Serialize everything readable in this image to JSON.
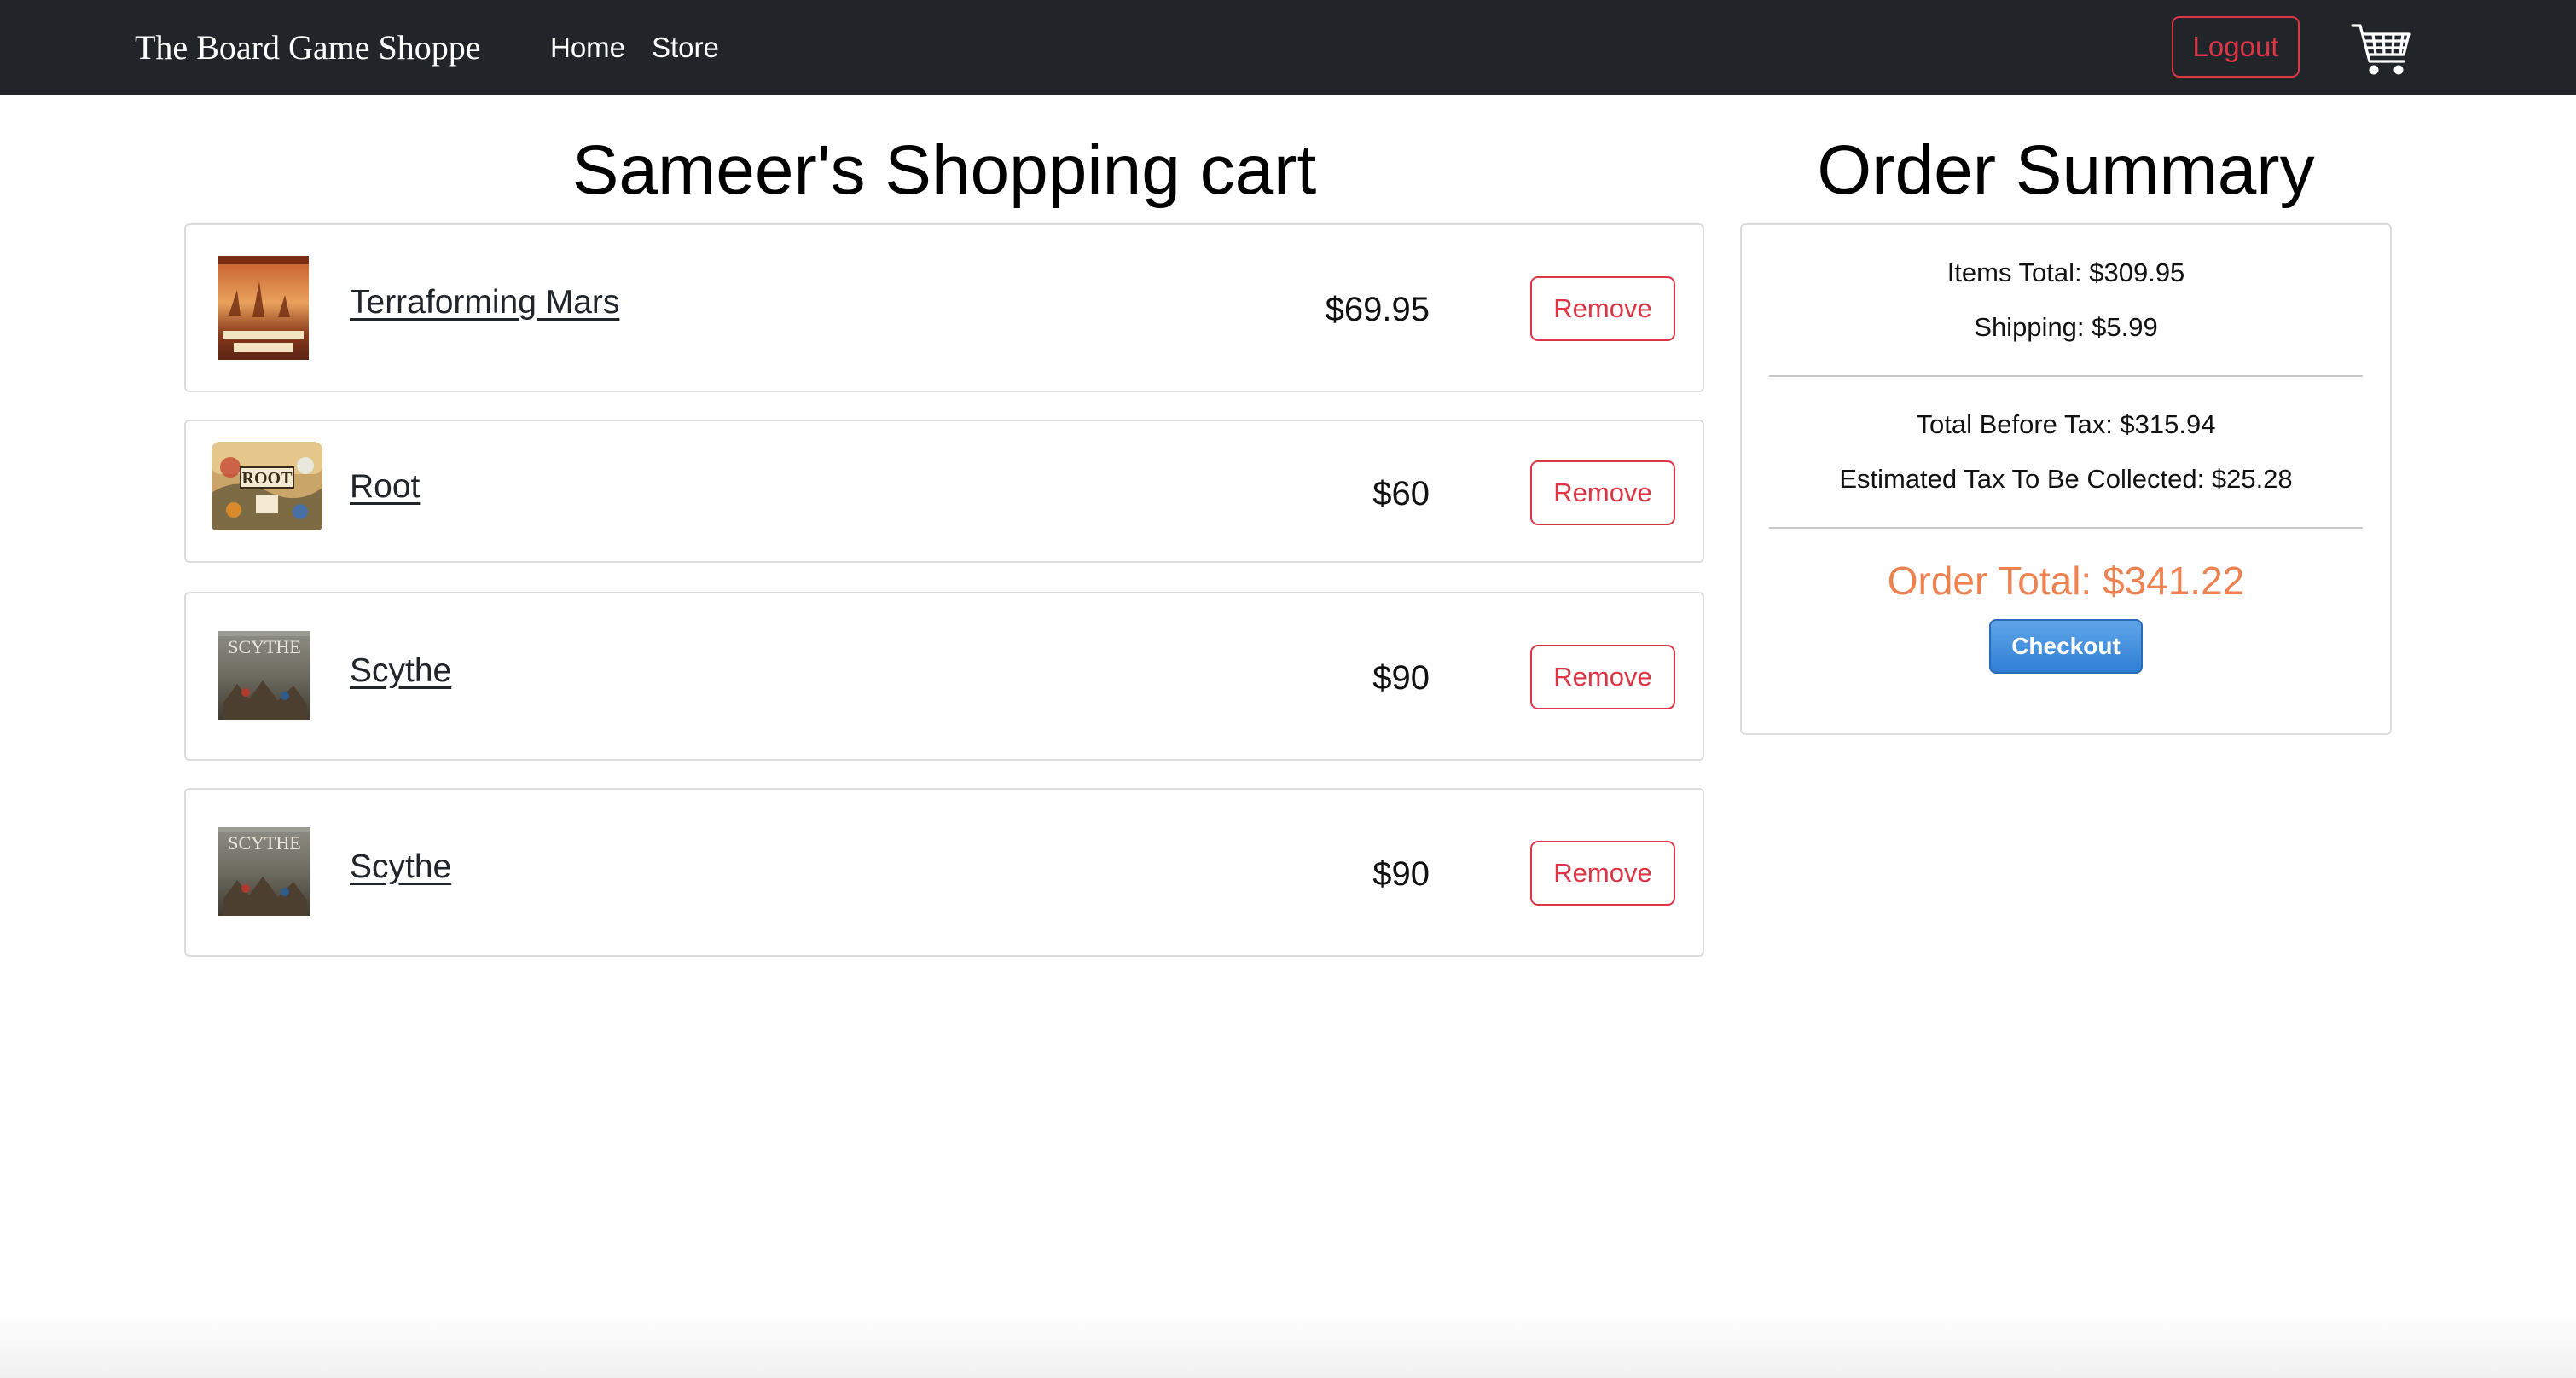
{
  "navbar": {
    "brand": "The Board Game Shoppe",
    "links": [
      "Home",
      "Store"
    ],
    "logout_label": "Logout",
    "cart_icon": "shopping-cart-icon"
  },
  "cart": {
    "title": "Sameer's Shopping cart",
    "remove_label": "Remove",
    "items": [
      {
        "name": "Terraforming Mars",
        "price": "$69.95",
        "thumb": "terraforming-mars-box"
      },
      {
        "name": "Root",
        "price": "$60",
        "thumb": "root-box"
      },
      {
        "name": "Scythe",
        "price": "$90",
        "thumb": "scythe-box"
      },
      {
        "name": "Scythe",
        "price": "$90",
        "thumb": "scythe-box"
      }
    ]
  },
  "summary": {
    "title": "Order Summary",
    "items_total": "Items Total: $309.95",
    "shipping": "Shipping: $5.99",
    "total_before_tax": "Total Before Tax: $315.94",
    "estimated_tax": "Estimated Tax To Be Collected: $25.28",
    "order_total": "Order Total: $341.22",
    "checkout_label": "Checkout"
  },
  "colors": {
    "navbar_bg": "#212529",
    "danger": "#dc3545",
    "order_total": "#ee8150",
    "checkout": "#2f7fd4"
  }
}
